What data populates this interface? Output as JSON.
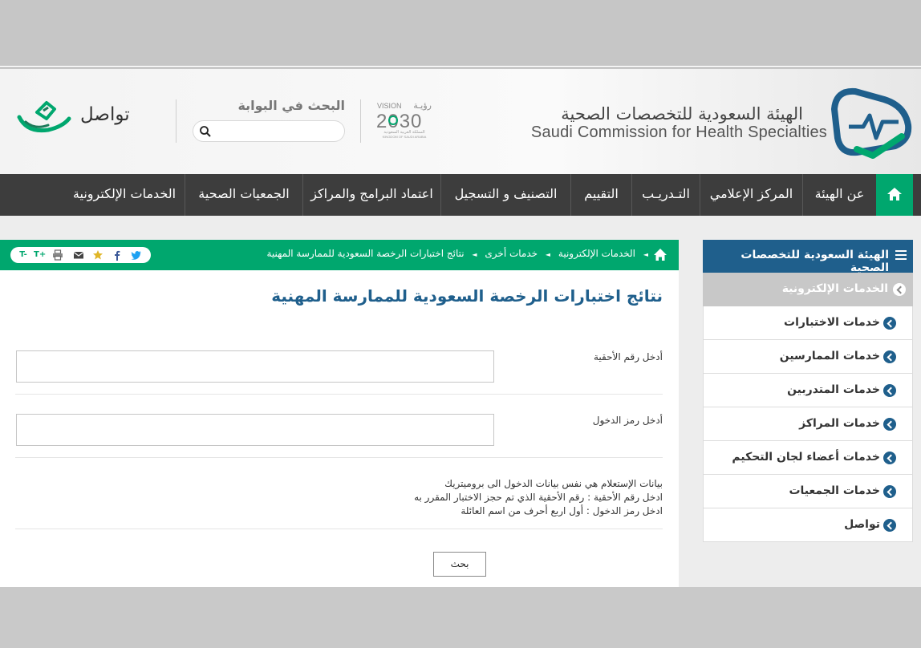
{
  "header": {
    "logo_ar": "الهيئة السعودية للتخصصات الصحية",
    "logo_en": "Saudi Commission for Health Specialties",
    "vision_label": "VISION",
    "vision_ar": "رؤيـة",
    "vision_year": "2030",
    "vision_sub_ar": "المملكة العربية السعودية",
    "vision_sub_en": "KINGDOM OF SAUDI ARABIA",
    "search_title": "البحث في البوابة",
    "search_placeholder": "",
    "tawasol": "تواصل"
  },
  "nav": {
    "items": [
      "عن الهيئة",
      "المركز الإعلامي",
      "التـدريـب",
      "التقييم",
      "التصنيف و التسجيل",
      "اعتماد البرامج والمراكز",
      "الجمعيات الصحية",
      "الخدمات الإلكترونية"
    ]
  },
  "breadcrumb": [
    "الخدمات الإلكترونية",
    "خدمات أخرى",
    "نتائج اختبارات الرخصة السعودية للممارسة المهنية"
  ],
  "share": {
    "font_up": "T+",
    "font_down": "T-"
  },
  "page_title": "نتائج اختبارات الرخصة السعودية للممارسة المهنية",
  "form": {
    "eligibility_label": "أدخل رقم الأحقية",
    "eligibility_value": "",
    "login_label": "أدخل رمز الدخول",
    "login_value": "",
    "notes": [
      "بيانات الإستعلام هي نفس بيانات الدخول الى بروميتريك",
      "ادخل رقم الأحقية : رقم الأحقية الذي تم حجز الاختبار المقرر به",
      "ادخل رمز الدخول : أول اربع أحرف من اسم العائلة"
    ],
    "search_button": "بحث"
  },
  "sidebar": {
    "title": "الهيئة السعودية للتخصصات الصحية",
    "items": [
      "الخدمات الإلكترونية",
      "خدمات الاختبارات",
      "خدمات الممارسين",
      "خدمات المتدربين",
      "خدمات المراكز",
      "خدمات أعضاء لجان التحكيم",
      "خدمات الجمعيات",
      "تواصل"
    ]
  },
  "colors": {
    "green": "#00a76e",
    "blue": "#1f5f8c",
    "nav": "#3d3d3d"
  }
}
